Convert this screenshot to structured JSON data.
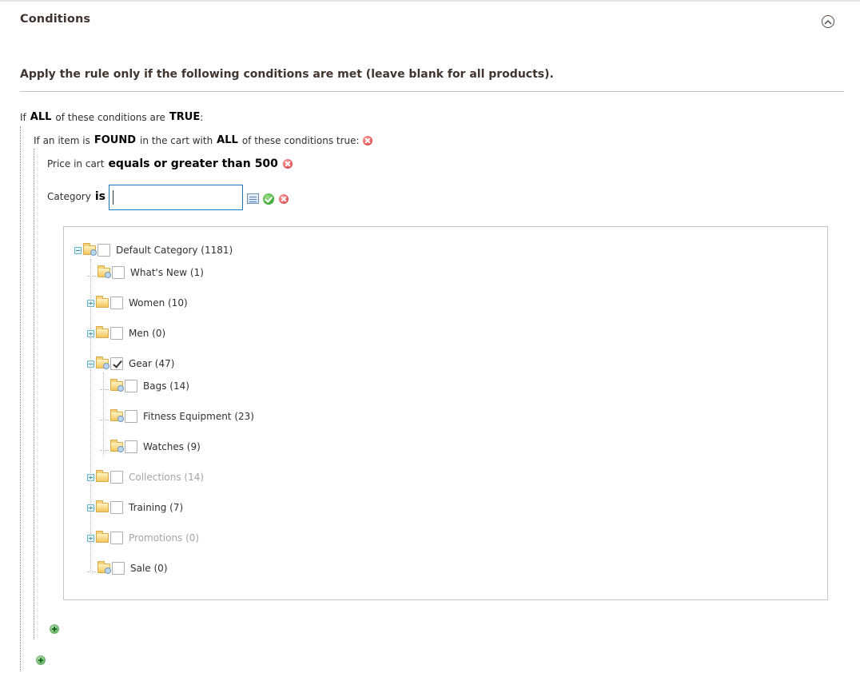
{
  "section": {
    "title": "Conditions",
    "collapse_icon": "chevron-up-circle-icon"
  },
  "fieldset": {
    "legend": "Apply the rule only if the following conditions are met (leave blank for all products)."
  },
  "root_condition": {
    "prefix": "If",
    "aggregator": "ALL",
    "middle": "of these conditions are",
    "value": "TRUE",
    "suffix": ":"
  },
  "found_condition": {
    "prefix": "If an item is",
    "found": "FOUND",
    "middle": "in the cart with",
    "aggregator": "ALL",
    "suffix": "of these conditions true:",
    "remove_icon": "remove-icon"
  },
  "price_condition": {
    "attribute": "Price in cart",
    "operator": "equals or greater than",
    "value": "500",
    "remove_icon": "remove-icon"
  },
  "category_condition": {
    "attribute": "Category",
    "operator": "is",
    "input_value": "",
    "chooser_icon": "list-chooser-icon",
    "apply_icon": "apply-check-icon",
    "remove_icon": "remove-icon"
  },
  "category_tree": [
    {
      "label": "Default Category (1181)",
      "level": 0,
      "toggle": "minus",
      "checked": false,
      "disabled": false,
      "folder": "open-search"
    },
    {
      "label": "What's New (1)",
      "level": 1,
      "toggle": "none",
      "checked": false,
      "disabled": false,
      "folder": "leaf"
    },
    {
      "label": "Women (10)",
      "level": 1,
      "toggle": "plus",
      "checked": false,
      "disabled": false,
      "folder": "closed"
    },
    {
      "label": "Men (0)",
      "level": 1,
      "toggle": "plus",
      "checked": false,
      "disabled": false,
      "folder": "closed"
    },
    {
      "label": "Gear (47)",
      "level": 1,
      "toggle": "minus",
      "checked": true,
      "disabled": false,
      "folder": "open-search"
    },
    {
      "label": "Bags (14)",
      "level": 2,
      "toggle": "none",
      "checked": false,
      "disabled": false,
      "folder": "leaf"
    },
    {
      "label": "Fitness Equipment (23)",
      "level": 2,
      "toggle": "none",
      "checked": false,
      "disabled": false,
      "folder": "leaf"
    },
    {
      "label": "Watches (9)",
      "level": 2,
      "toggle": "none",
      "checked": false,
      "disabled": false,
      "folder": "leaf"
    },
    {
      "label": "Collections (14)",
      "level": 1,
      "toggle": "plus",
      "checked": false,
      "disabled": true,
      "folder": "closed"
    },
    {
      "label": "Training (7)",
      "level": 1,
      "toggle": "plus",
      "checked": false,
      "disabled": false,
      "folder": "closed"
    },
    {
      "label": "Promotions (0)",
      "level": 1,
      "toggle": "plus",
      "checked": false,
      "disabled": true,
      "folder": "closed"
    },
    {
      "label": "Sale (0)",
      "level": 1,
      "toggle": "none",
      "checked": false,
      "disabled": false,
      "folder": "leaf"
    }
  ],
  "add_buttons": {
    "inner_icon": "add-condition-icon",
    "outer_icon": "add-condition-icon"
  }
}
